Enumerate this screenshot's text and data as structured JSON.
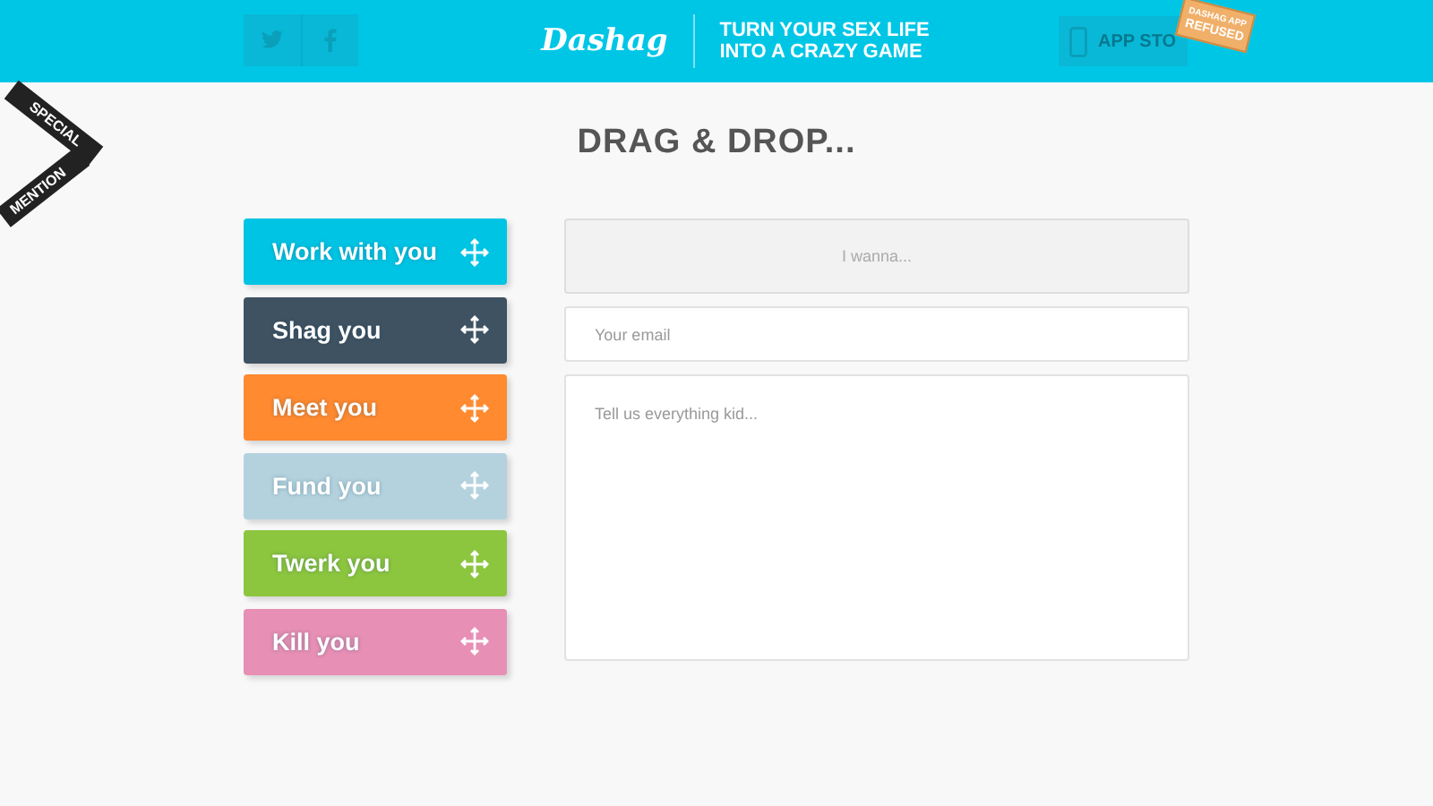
{
  "header": {
    "social": [
      {
        "kind": "twitter"
      },
      {
        "kind": "facebook"
      }
    ],
    "logo": "Dashag",
    "tagline": [
      "TURN YOUR SEX LIFE",
      "INTO A CRAZY GAME"
    ],
    "app_store": {
      "label": "APP STO"
    },
    "stamp": [
      "DASHAG APP",
      "REFUSED"
    ]
  },
  "ribbon": [
    "SPECIAL",
    "MENTION"
  ],
  "title": "DRAG & DROP...",
  "options": [
    {
      "label": "Work with you",
      "color": "#00c4e4"
    },
    {
      "label": "Shag you",
      "color": "#3f5262"
    },
    {
      "label": "Meet you",
      "color": "#ff8a30"
    },
    {
      "label": "Fund you",
      "color": "#b4d2de"
    },
    {
      "label": "Twerk you",
      "color": "#8cc63f"
    },
    {
      "label": "Kill you",
      "color": "#e78fb5"
    }
  ],
  "form": {
    "drop_zone": "I wanna...",
    "email": {
      "placeholder": "Your email"
    },
    "message": {
      "placeholder": "Tell us everything kid..."
    }
  }
}
